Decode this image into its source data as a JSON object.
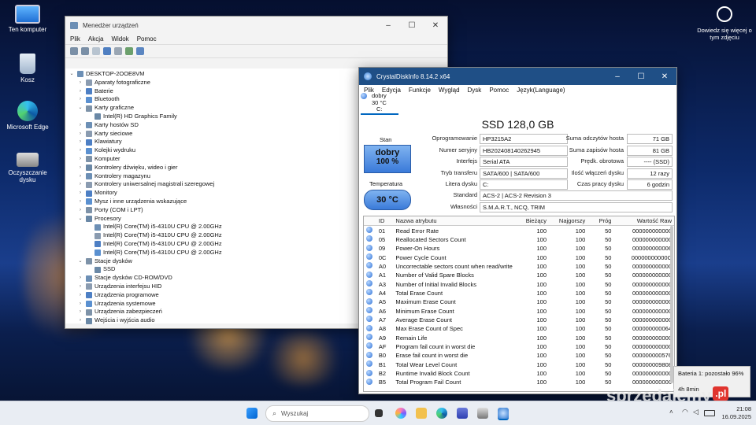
{
  "desktop": {
    "icons": [
      {
        "label": "Ten komputer",
        "icon": "monitor-icon"
      },
      {
        "label": "Kosz",
        "icon": "recycle-bin-icon"
      },
      {
        "label": "Microsoft Edge",
        "icon": "edge-icon"
      },
      {
        "label": "Oczyszczanie dysku",
        "icon": "disk-cleanup-icon"
      }
    ],
    "right_panel": {
      "text": "Dowiedz się więcej o tym zdjęciu"
    }
  },
  "device_manager": {
    "title": "Menedżer urządzeń",
    "menu": [
      "Plik",
      "Akcja",
      "Widok",
      "Pomoc"
    ],
    "tree": [
      {
        "level": 0,
        "expanded": true,
        "label": "DESKTOP-2OOE8VM",
        "icon": "computer-icon"
      },
      {
        "level": 1,
        "expanded": false,
        "label": "Aparaty fotograficzne",
        "icon": "camera-icon"
      },
      {
        "level": 1,
        "expanded": false,
        "label": "Baterie",
        "icon": "battery-icon"
      },
      {
        "level": 1,
        "expanded": false,
        "label": "Bluetooth",
        "icon": "bluetooth-icon"
      },
      {
        "level": 1,
        "expanded": true,
        "label": "Karty graficzne",
        "icon": "display-adapter-icon"
      },
      {
        "level": 2,
        "expanded": null,
        "label": "Intel(R) HD Graphics Family",
        "icon": "display-adapter-icon"
      },
      {
        "level": 1,
        "expanded": false,
        "label": "Karty hostów SD",
        "icon": "sd-host-icon"
      },
      {
        "level": 1,
        "expanded": false,
        "label": "Karty sieciowe",
        "icon": "network-adapter-icon"
      },
      {
        "level": 1,
        "expanded": false,
        "label": "Klawiatury",
        "icon": "keyboard-icon"
      },
      {
        "level": 1,
        "expanded": false,
        "label": "Kolejki wydruku",
        "icon": "print-queue-icon"
      },
      {
        "level": 1,
        "expanded": false,
        "label": "Komputer",
        "icon": "computer-icon"
      },
      {
        "level": 1,
        "expanded": false,
        "label": "Kontrolery dźwięku, wideo i gier",
        "icon": "sound-icon"
      },
      {
        "level": 1,
        "expanded": false,
        "label": "Kontrolery magazynu",
        "icon": "storage-controller-icon"
      },
      {
        "level": 1,
        "expanded": false,
        "label": "Kontrolery uniwersalnej magistrali szeregowej",
        "icon": "usb-icon"
      },
      {
        "level": 1,
        "expanded": false,
        "label": "Monitory",
        "icon": "monitor-icon"
      },
      {
        "level": 1,
        "expanded": false,
        "label": "Mysz i inne urządzenia wskazujące",
        "icon": "mouse-icon"
      },
      {
        "level": 1,
        "expanded": false,
        "label": "Porty (COM i LPT)",
        "icon": "port-icon"
      },
      {
        "level": 1,
        "expanded": true,
        "label": "Procesory",
        "icon": "processor-icon"
      },
      {
        "level": 2,
        "expanded": null,
        "label": "Intel(R) Core(TM) i5-4310U CPU @ 2.00GHz",
        "icon": "processor-icon"
      },
      {
        "level": 2,
        "expanded": null,
        "label": "Intel(R) Core(TM) i5-4310U CPU @ 2.00GHz",
        "icon": "processor-icon"
      },
      {
        "level": 2,
        "expanded": null,
        "label": "Intel(R) Core(TM) i5-4310U CPU @ 2.00GHz",
        "icon": "processor-icon"
      },
      {
        "level": 2,
        "expanded": null,
        "label": "Intel(R) Core(TM) i5-4310U CPU @ 2.00GHz",
        "icon": "processor-icon"
      },
      {
        "level": 1,
        "expanded": true,
        "label": "Stacje dysków",
        "icon": "disk-drive-icon"
      },
      {
        "level": 2,
        "expanded": null,
        "label": "SSD",
        "icon": "disk-drive-icon"
      },
      {
        "level": 1,
        "expanded": false,
        "label": "Stacje dysków CD-ROM/DVD",
        "icon": "dvd-icon"
      },
      {
        "level": 1,
        "expanded": false,
        "label": "Urządzenia interfejsu HID",
        "icon": "hid-icon"
      },
      {
        "level": 1,
        "expanded": false,
        "label": "Urządzenia programowe",
        "icon": "software-device-icon"
      },
      {
        "level": 1,
        "expanded": false,
        "label": "Urządzenia systemowe",
        "icon": "system-device-icon"
      },
      {
        "level": 1,
        "expanded": false,
        "label": "Urządzenia zabezpieczeń",
        "icon": "security-device-icon"
      },
      {
        "level": 1,
        "expanded": false,
        "label": "Wejścia i wyjścia audio",
        "icon": "audio-io-icon"
      }
    ]
  },
  "crystal": {
    "title": "CrystalDiskInfo 8.14.2 x64",
    "menu": [
      "Plik",
      "Edycja",
      "Funkcje",
      "Wygląd",
      "Dysk",
      "Pomoc",
      "Język(Language)"
    ],
    "drive_tab": {
      "status": "dobry",
      "temp": "30 °C",
      "letter": "C:"
    },
    "disk_title": "SSD 128,0 GB",
    "status_label": "Stan",
    "status_value": "dobry",
    "status_percent": "100 %",
    "temp_label": "Temperatura",
    "temp_value": "30 °C",
    "left_fields": [
      {
        "label": "Oprogramowanie",
        "value": "HP3215A2"
      },
      {
        "label": "Numer seryjny",
        "value": "HB202408140262945"
      },
      {
        "label": "Interfejs",
        "value": "Serial ATA"
      },
      {
        "label": "Tryb transferu",
        "value": "SATA/600 | SATA/600"
      },
      {
        "label": "Litera dysku",
        "value": "C:"
      }
    ],
    "right_fields": [
      {
        "label": "Suma odczytów hosta",
        "value": "71 GB"
      },
      {
        "label": "Suma zapisów hosta",
        "value": "81 GB"
      },
      {
        "label": "Prędk. obrotowa",
        "value": "---- (SSD)"
      },
      {
        "label": "Ilość włączeń dysku",
        "value": "12 razy"
      },
      {
        "label": "Czas pracy dysku",
        "value": "6 godzin"
      }
    ],
    "wide_fields": [
      {
        "label": "Standard",
        "value": "ACS-2 | ACS-2 Revision 3"
      },
      {
        "label": "Własności",
        "value": "S.M.A.R.T., NCQ, TRIM"
      }
    ],
    "columns": [
      "ID",
      "Nazwa atrybutu",
      "Bieżący",
      "Najgorszy",
      "Próg",
      "Wartość Raw"
    ],
    "rows": [
      [
        "01",
        "Read Error Rate",
        "100",
        "100",
        "50",
        "000000000000"
      ],
      [
        "05",
        "Reallocated Sectors Count",
        "100",
        "100",
        "50",
        "000000000000"
      ],
      [
        "09",
        "Power-On Hours",
        "100",
        "100",
        "50",
        "000000000006"
      ],
      [
        "0C",
        "Power Cycle Count",
        "100",
        "100",
        "50",
        "00000000000C"
      ],
      [
        "A0",
        "Uncorrectable sectors count when read/write",
        "100",
        "100",
        "50",
        "000000000000"
      ],
      [
        "A1",
        "Number of Valid Spare Blocks",
        "100",
        "100",
        "50",
        "000000000000"
      ],
      [
        "A3",
        "Number of Initial Invalid Blocks",
        "100",
        "100",
        "50",
        "000000000000"
      ],
      [
        "A4",
        "Total Erase Count",
        "100",
        "100",
        "50",
        "000000000000"
      ],
      [
        "A5",
        "Maximum Erase Count",
        "100",
        "100",
        "50",
        "000000000000"
      ],
      [
        "A6",
        "Minimum Erase Count",
        "100",
        "100",
        "50",
        "000000000000"
      ],
      [
        "A7",
        "Average Erase Count",
        "100",
        "100",
        "50",
        "000000000000"
      ],
      [
        "A8",
        "Max Erase Count of Spec",
        "100",
        "100",
        "50",
        "000000000064"
      ],
      [
        "A9",
        "Remain Life",
        "100",
        "100",
        "50",
        "000000000000"
      ],
      [
        "AF",
        "Program fail count in worst die",
        "100",
        "100",
        "50",
        "000000000000"
      ],
      [
        "B0",
        "Erase fail count in worst die",
        "100",
        "100",
        "50",
        "000000000576"
      ],
      [
        "B1",
        "Total Wear Level Count",
        "100",
        "100",
        "50",
        "000000009808"
      ],
      [
        "B2",
        "Runtime Invalid Block Count",
        "100",
        "100",
        "50",
        "000000000000"
      ],
      [
        "B5",
        "Total Program Fail Count",
        "100",
        "100",
        "50",
        "000000000000"
      ]
    ]
  },
  "battery_tooltip": {
    "title": "Bateria 1: pozostało 96%",
    "time": "4h 8min"
  },
  "taskbar": {
    "search_placeholder": "Wyszukaj",
    "time": "21:08",
    "date": "16.09.2025"
  },
  "watermark": {
    "text": "sprzedajemy",
    "suffix": ".pl"
  },
  "colors": {
    "good_blue": "#3a7ad9",
    "accent": "#0067c0"
  }
}
